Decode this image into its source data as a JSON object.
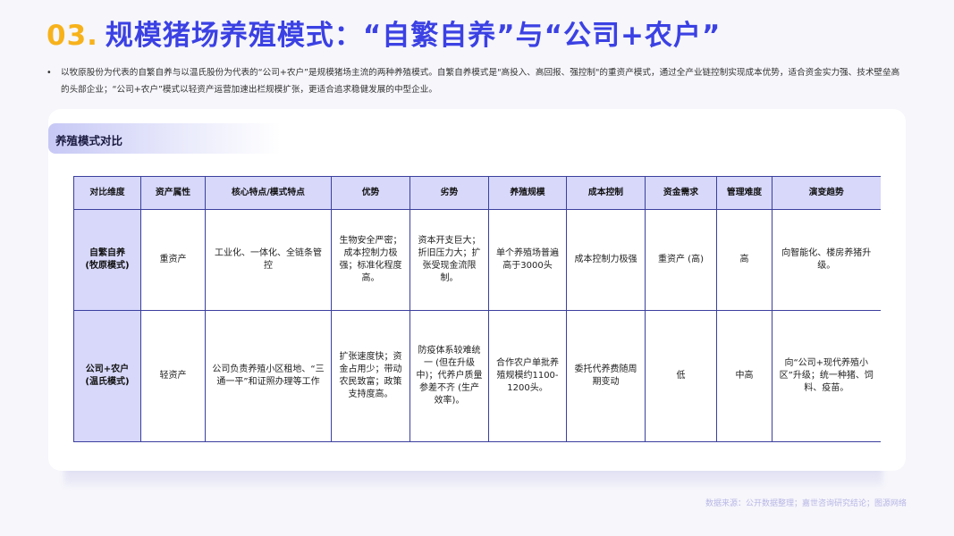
{
  "title": {
    "number": "03.",
    "text": "规模猪场养殖模式：“自繁自养”与“公司+农户”"
  },
  "intro": {
    "bullet": "•",
    "text": "以牧原股份为代表的自繁自养与以温氏股份为代表的“公司+农户”是规模猪场主流的两种养殖模式。自繁自养模式是\"高投入、高回报、强控制\"的重资产模式，通过全产业链控制实现成本优势，适合资金实力强、技术壁垒高的头部企业；“公司+农户”模式以轻资产运营加速出栏规模扩张，更适合追求稳健发展的中型企业。"
  },
  "section": {
    "label": "养殖模式对比"
  },
  "table": {
    "headers": [
      "对比维度",
      "资产属性",
      "核心特点/模式特点",
      "优势",
      "劣势",
      "养殖规模",
      "成本控制",
      "资金需求",
      "管理难度",
      "演变趋势"
    ],
    "rows": [
      {
        "label": "自繁自养\n(牧原模式)",
        "cells": [
          "重资产",
          "工业化、一体化、全链条管控",
          "生物安全严密；成本控制力极强；标准化程度高。",
          "资本开支巨大；折旧压力大；扩张受现金流限制。",
          "单个养殖场普遍高于3000头",
          "成本控制力极强",
          "重资产 (高)",
          "高",
          "向智能化、楼房养猪升级。"
        ]
      },
      {
        "label": "公司+农户\n(温氏模式)",
        "cells": [
          "轻资产",
          "公司负责养殖小区租地、“三通一平”和证照办理等工作",
          "扩张速度快；资金占用少；带动农民致富；政策支持度高。",
          "防疫体系较难统一 (但在升级中)；代养户质量参差不齐 (生产效率)。",
          "合作农户单批养殖规模约1100-1200头。",
          "委托代养费随周期变动",
          "低",
          "中高",
          "向“公司+现代养殖小区”升级；统一种猪、饲料、疫苗。"
        ]
      }
    ]
  },
  "footnote": "数据来源：公开数据整理；嘉世咨询研究结论；图源网络",
  "colors": {
    "title_blue": "#3b41e3",
    "title_number": "#f7b21b",
    "header_bg": "#d7d8fa",
    "border": "#3b3f9e",
    "footnote": "#b8b6e6"
  }
}
